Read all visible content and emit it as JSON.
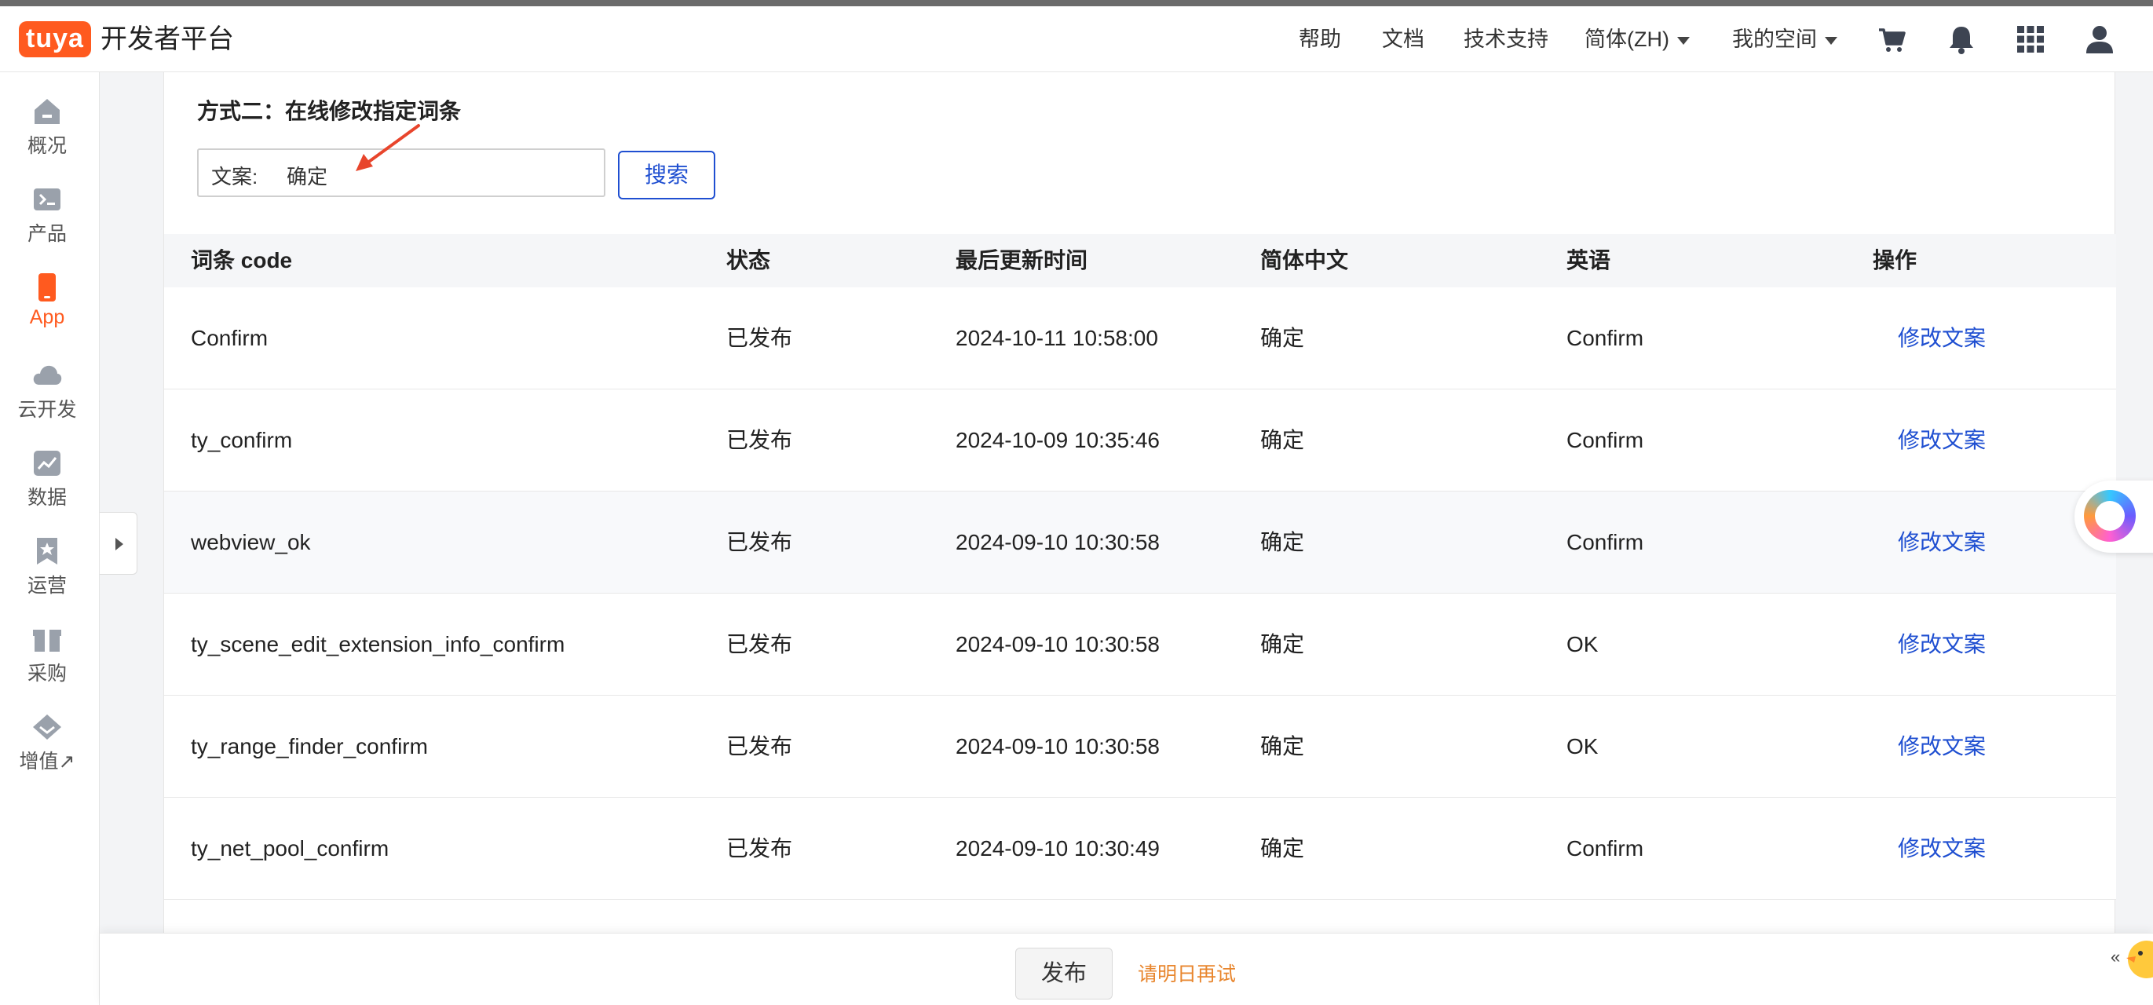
{
  "header": {
    "logo_text": "tuya",
    "title": "开发者平台",
    "nav": {
      "help": "帮助",
      "docs": "文档",
      "support": "技术支持",
      "language": "简体(ZH)",
      "my_space": "我的空间"
    },
    "icons": [
      "cart-icon",
      "bell-icon",
      "apps-grid-icon",
      "user-icon"
    ]
  },
  "sidebar": {
    "items": [
      {
        "label": "概况",
        "icon": "home-icon",
        "active": false
      },
      {
        "label": "产品",
        "icon": "terminal-icon",
        "active": false
      },
      {
        "label": "App",
        "icon": "phone-icon",
        "active": true
      },
      {
        "label": "云开发",
        "icon": "cloud-icon",
        "active": false
      },
      {
        "label": "数据",
        "icon": "chart-icon",
        "active": false
      },
      {
        "label": "运营",
        "icon": "bookmark-icon",
        "active": false
      },
      {
        "label": "采购",
        "icon": "box-icon",
        "active": false
      },
      {
        "label": "增值↗",
        "icon": "diamond-icon",
        "active": false
      }
    ],
    "accent_color": "#ff5a1f"
  },
  "main": {
    "section_title": "方式二：在线修改指定词条",
    "search": {
      "label": "文案:",
      "value": "确定",
      "button": "搜索"
    },
    "table": {
      "columns": [
        "词条 code",
        "状态",
        "最后更新时间",
        "简体中文",
        "英语",
        "操作"
      ],
      "rows": [
        {
          "code": "Confirm",
          "status": "已发布",
          "updated": "2024-10-11 10:58:00",
          "zh": "确定",
          "en": "Confirm",
          "action": "修改文案"
        },
        {
          "code": "ty_confirm",
          "status": "已发布",
          "updated": "2024-10-09 10:35:46",
          "zh": "确定",
          "en": "Confirm",
          "action": "修改文案"
        },
        {
          "code": "webview_ok",
          "status": "已发布",
          "updated": "2024-09-10 10:30:58",
          "zh": "确定",
          "en": "Confirm",
          "action": "修改文案"
        },
        {
          "code": "ty_scene_edit_extension_info_confirm",
          "status": "已发布",
          "updated": "2024-09-10 10:30:58",
          "zh": "确定",
          "en": "OK",
          "action": "修改文案"
        },
        {
          "code": "ty_range_finder_confirm",
          "status": "已发布",
          "updated": "2024-09-10 10:30:58",
          "zh": "确定",
          "en": "OK",
          "action": "修改文案"
        },
        {
          "code": "ty_net_pool_confirm",
          "status": "已发布",
          "updated": "2024-09-10 10:30:49",
          "zh": "确定",
          "en": "Confirm",
          "action": "修改文案"
        }
      ]
    }
  },
  "footer": {
    "publish_button": "发布",
    "retry_text": "请明日再试"
  },
  "colors": {
    "link": "#1f4fd1",
    "warning": "#e8862e",
    "annotation_arrow": "#e8452c"
  }
}
